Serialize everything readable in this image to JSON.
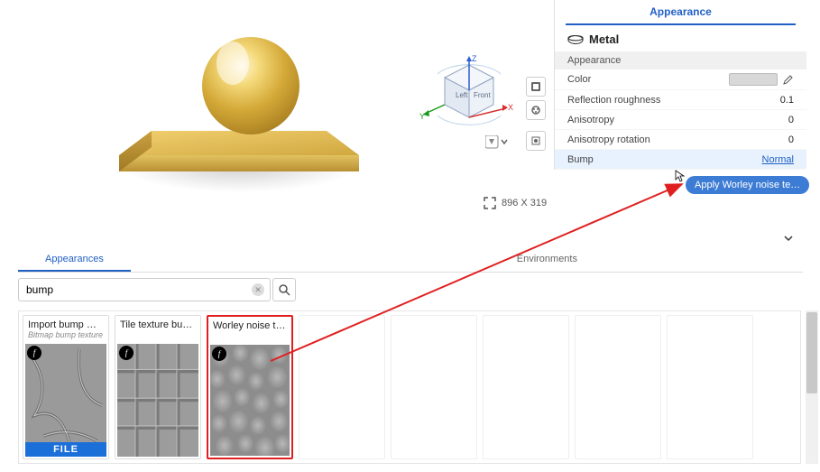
{
  "panel": {
    "title": "Appearance",
    "material_name": "Metal",
    "section": "Appearance",
    "props": {
      "color_label": "Color",
      "roughness_label": "Reflection roughness",
      "roughness_value": "0.1",
      "aniso_label": "Anisotropy",
      "aniso_value": "0",
      "aniso_rot_label": "Anisotropy rotation",
      "aniso_rot_value": "0",
      "bump_label": "Bump",
      "bump_value": "Normal"
    }
  },
  "tooltip_text": "Apply Worley noise te…",
  "viewport": {
    "dimensions_label": "896 X 319",
    "axes": {
      "x": "X",
      "y": "Y",
      "z": "Z"
    },
    "cube": {
      "left": "Left",
      "front": "Front"
    }
  },
  "tabs": {
    "appearances": "Appearances",
    "environments": "Environments"
  },
  "search": {
    "value": "bump",
    "placeholder": ""
  },
  "thumbnails": [
    {
      "title": "Import bump m…",
      "subtitle": "Bitmap bump texture",
      "kind": "file"
    },
    {
      "title": "Tile texture bu…",
      "subtitle": "",
      "kind": "tile"
    },
    {
      "title": "Worley noise te…",
      "subtitle": "",
      "kind": "worley",
      "selected": true
    }
  ]
}
